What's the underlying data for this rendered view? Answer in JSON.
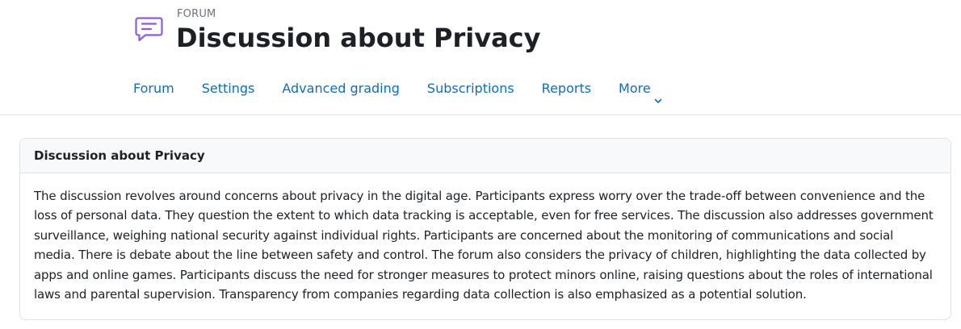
{
  "header": {
    "eyebrow": "FORUM",
    "title": "Discussion about Privacy",
    "icon": "forum-icon",
    "icon_color": "#8f5bd9"
  },
  "nav": {
    "items": [
      {
        "label": "Forum"
      },
      {
        "label": "Settings"
      },
      {
        "label": "Advanced grading"
      },
      {
        "label": "Subscriptions"
      },
      {
        "label": "Reports"
      },
      {
        "label": "More"
      }
    ],
    "link_color": "#0f6cbf"
  },
  "card": {
    "title": "Discussion about Privacy",
    "body": "The discussion revolves around concerns about privacy in the digital age. Participants express worry over the trade-off between convenience and the loss of personal data. They question the extent to which data tracking is acceptable, even for free services. The discussion also addresses government surveillance, weighing national security against individual rights. Participants are concerned about the monitoring of communications and social media. There is debate about the line between safety and control. The forum also considers the privacy of children, highlighting the data collected by apps and online games. Participants discuss the need for stronger measures to protect minors online, raising questions about the roles of international laws and parental supervision. Transparency from companies regarding data collection is also emphasized as a potential solution."
  }
}
